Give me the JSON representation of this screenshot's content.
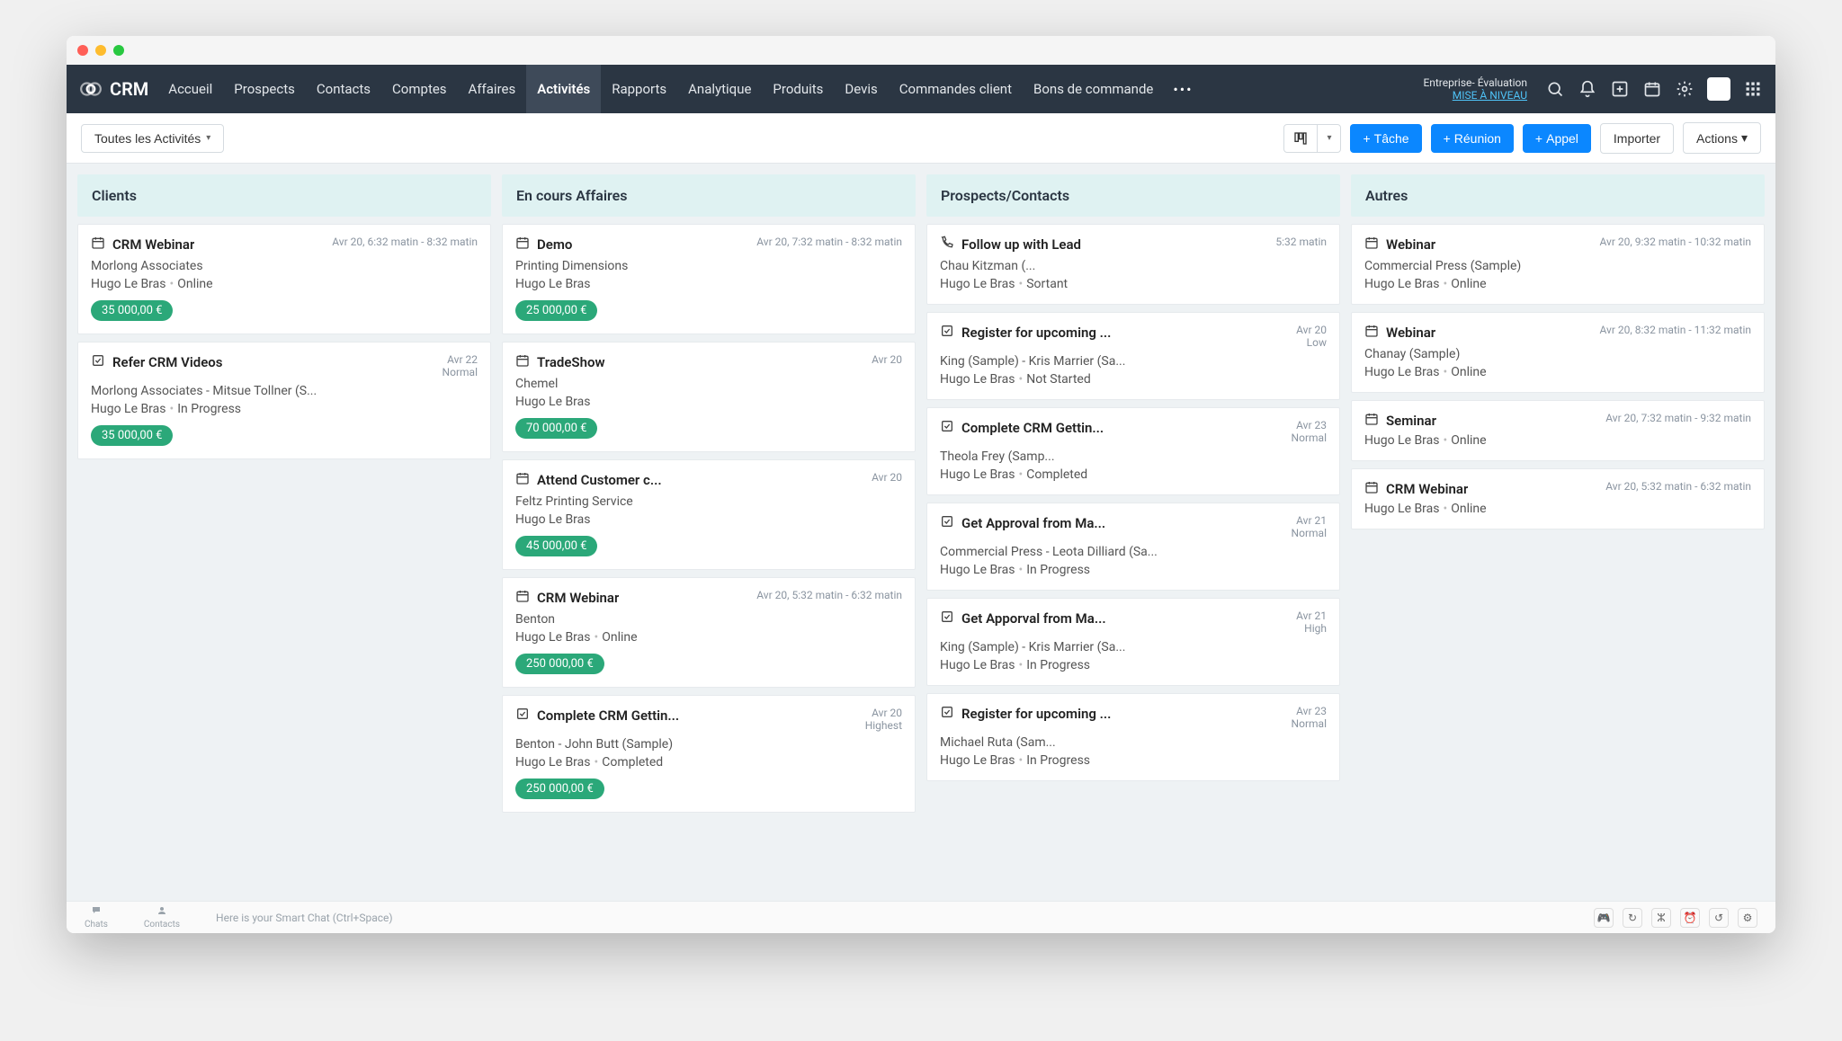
{
  "app_name": "CRM",
  "nav": [
    "Accueil",
    "Prospects",
    "Contacts",
    "Comptes",
    "Affaires",
    "Activités",
    "Rapports",
    "Analytique",
    "Produits",
    "Devis",
    "Commandes client",
    "Bons de commande"
  ],
  "nav_active_index": 5,
  "trial": {
    "line1": "Entreprise- Évaluation",
    "line2": "MISE À NIVEAU"
  },
  "toolbar": {
    "filter_label": "Toutes les Activités",
    "task": "Tâche",
    "meeting": "Réunion",
    "call": "Appel",
    "import": "Importer",
    "actions": "Actions"
  },
  "columns": [
    {
      "title": "Clients",
      "cards": [
        {
          "icon": "event",
          "title": "CRM Webinar",
          "time": "Avr 20, 6:32 matin - 8:32 matin",
          "sub": "Morlong Associates",
          "owner": "Hugo Le Bras",
          "status": "Online",
          "amount": "35 000,00 €"
        },
        {
          "icon": "task",
          "title": "Refer CRM Videos",
          "time": "Avr 22",
          "time2": "Normal",
          "sub": "Morlong Associates - Mitsue Tollner (S...",
          "owner": "Hugo Le Bras",
          "status": "In Progress",
          "amount": "35 000,00 €"
        }
      ]
    },
    {
      "title": "En cours Affaires",
      "cards": [
        {
          "icon": "event",
          "title": "Demo",
          "time": "Avr 20, 7:32 matin - 8:32 matin",
          "sub": "Printing Dimensions",
          "owner": "Hugo Le Bras",
          "amount": "25 000,00 €"
        },
        {
          "icon": "event",
          "title": "TradeShow",
          "time": "Avr 20",
          "sub": "Chemel",
          "owner": "Hugo Le Bras",
          "amount": "70 000,00 €"
        },
        {
          "icon": "event",
          "title": "Attend Customer c...",
          "time": "Avr 20",
          "sub": "Feltz Printing Service",
          "owner": "Hugo Le Bras",
          "amount": "45 000,00 €"
        },
        {
          "icon": "event",
          "title": "CRM Webinar",
          "time": "Avr 20, 5:32 matin - 6:32 matin",
          "sub": "Benton",
          "owner": "Hugo Le Bras",
          "status": "Online",
          "amount": "250 000,00 €"
        },
        {
          "icon": "task",
          "title": "Complete CRM Gettin...",
          "time": "Avr 20",
          "time2": "Highest",
          "sub": "Benton - John Butt (Sample)",
          "owner": "Hugo Le Bras",
          "status": "Completed",
          "amount": "250 000,00 €"
        }
      ]
    },
    {
      "title": "Prospects/Contacts",
      "cards": [
        {
          "icon": "call",
          "title": "Follow up with Lead",
          "time": "5:32 matin",
          "sub": "Chau Kitzman (...",
          "owner": "Hugo Le Bras",
          "status": "Sortant"
        },
        {
          "icon": "task",
          "title": "Register for upcoming ...",
          "time": "Avr 20",
          "time2": "Low",
          "sub": "King (Sample) - Kris Marrier (Sa...",
          "owner": "Hugo Le Bras",
          "status": "Not Started"
        },
        {
          "icon": "task",
          "title": "Complete CRM Gettin...",
          "time": "Avr 23",
          "time2": "Normal",
          "sub": "Theola Frey (Samp...",
          "owner": "Hugo Le Bras",
          "status": "Completed"
        },
        {
          "icon": "task",
          "title": "Get Approval from Ma...",
          "time": "Avr 21",
          "time2": "Normal",
          "sub": "Commercial Press - Leota Dilliard (Sa...",
          "owner": "Hugo Le Bras",
          "status": "In Progress"
        },
        {
          "icon": "task",
          "title": "Get Apporval from Ma...",
          "time": "Avr 21",
          "time2": "High",
          "sub": "King (Sample) - Kris Marrier (Sa...",
          "owner": "Hugo Le Bras",
          "status": "In Progress"
        },
        {
          "icon": "task",
          "title": "Register for upcoming ...",
          "time": "Avr 23",
          "time2": "Normal",
          "sub": "Michael Ruta (Sam...",
          "owner": "Hugo Le Bras",
          "status": "In Progress"
        }
      ]
    },
    {
      "title": "Autres",
      "cards": [
        {
          "icon": "event",
          "title": "Webinar",
          "time": "Avr 20, 9:32 matin - 10:32 matin",
          "sub": "Commercial Press (Sample)",
          "owner": "Hugo Le Bras",
          "status": "Online"
        },
        {
          "icon": "event",
          "title": "Webinar",
          "time": "Avr 20, 8:32 matin - 11:32 matin",
          "sub": "Chanay (Sample)",
          "owner": "Hugo Le Bras",
          "status": "Online"
        },
        {
          "icon": "event",
          "title": "Seminar",
          "time": "Avr 20, 7:32 matin - 9:32 matin",
          "owner": "Hugo Le Bras",
          "status": "Online"
        },
        {
          "icon": "event",
          "title": "CRM Webinar",
          "time": "Avr 20, 5:32 matin - 6:32 matin",
          "owner": "Hugo Le Bras",
          "status": "Online"
        }
      ]
    }
  ],
  "footer": {
    "chats": "Chats",
    "contacts": "Contacts",
    "smart_chat": "Here is your Smart Chat (Ctrl+Space)"
  }
}
